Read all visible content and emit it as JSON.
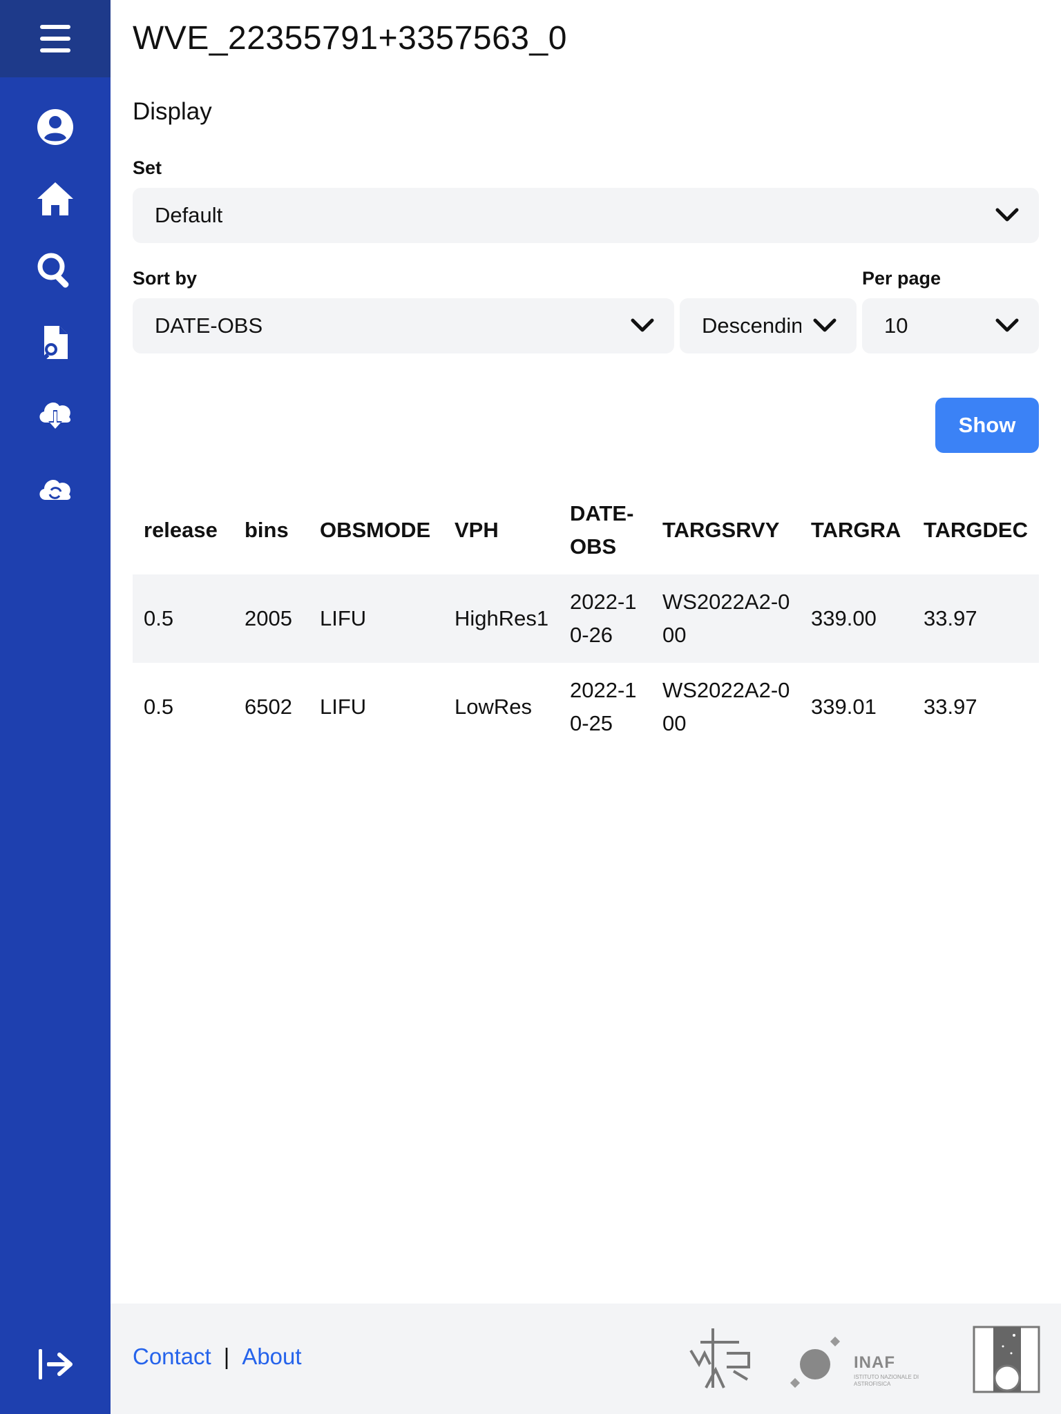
{
  "page_title": "WVE_22355791+3357563_0",
  "display": {
    "section_title": "Display",
    "set_label": "Set",
    "set_value": "Default",
    "sort_label": "Sort by",
    "sort_value": "DATE-OBS",
    "order_value": "Descending",
    "per_page_label": "Per page",
    "per_page_value": "10",
    "show_label": "Show"
  },
  "table": {
    "columns": [
      "release",
      "bins",
      "OBSMODE",
      "VPH",
      "DATE-OBS",
      "TARGSRVY",
      "TARGRA",
      "TARGDEC"
    ],
    "rows": [
      {
        "release": "0.5",
        "bins": "2005",
        "obsmode": "LIFU",
        "vph": "HighRes1",
        "date_obs": "2022-10-26",
        "targsrvy": "WS2022A2-000",
        "targra": "339.00",
        "targdec": "33.97"
      },
      {
        "release": "0.5",
        "bins": "6502",
        "obsmode": "LIFU",
        "vph": "LowRes",
        "date_obs": "2022-10-25",
        "targsrvy": "WS2022A2-000",
        "targra": "339.01",
        "targdec": "33.97"
      }
    ]
  },
  "footer": {
    "contact_label": "Contact",
    "separator": "|",
    "about_label": "About",
    "inaf_logo_text": "INAF",
    "inaf_logo_subtext": "ISTITUTO NAZIONALE DI ASTROFISICA"
  },
  "colors": {
    "sidebar": "#1e40af",
    "sidebar_top": "#1e3a8a",
    "accent_button": "#3b82f6",
    "link": "#2563eb",
    "field_bg": "#f3f4f6"
  },
  "icons": [
    "menu-icon",
    "user-circle-icon",
    "home-icon",
    "search-icon",
    "file-search-icon",
    "cloud-download-icon",
    "cloud-sync-icon",
    "logout-icon"
  ]
}
